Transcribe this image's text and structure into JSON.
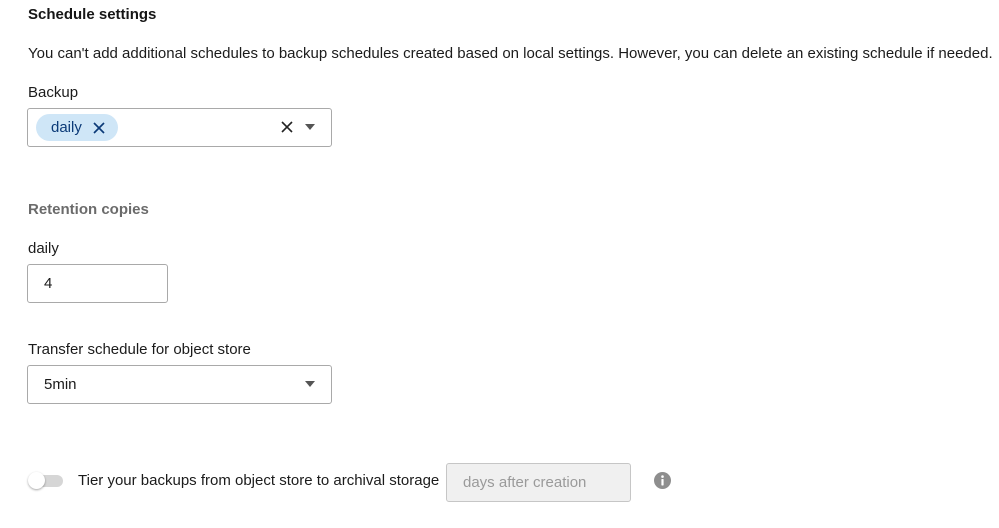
{
  "schedule_settings": {
    "title": "Schedule settings",
    "info_text": "You can't add additional schedules to backup schedules created based on local settings. However, you can delete an existing schedule if needed."
  },
  "backup": {
    "label": "Backup",
    "selected_chip": "daily",
    "icons": {
      "chip_remove": "close-icon",
      "clear": "close-icon",
      "dropdown": "caret-down-icon"
    }
  },
  "retention": {
    "title": "Retention copies",
    "daily_label": "daily",
    "daily_value": "4"
  },
  "transfer": {
    "label": "Transfer schedule for object store",
    "value": "5min",
    "dropdown_icon": "caret-down-icon"
  },
  "tier": {
    "toggle_on": false,
    "label": "Tier your backups from object store to archival storage",
    "days_placeholder": "days after creation",
    "info_icon": "info-icon"
  },
  "colors": {
    "chip_bg": "#cfe6f7",
    "chip_text": "#0b3a78",
    "border": "#a9a9a9",
    "disabled_bg": "#f0f0f0",
    "muted_heading": "#6b6b6b"
  }
}
